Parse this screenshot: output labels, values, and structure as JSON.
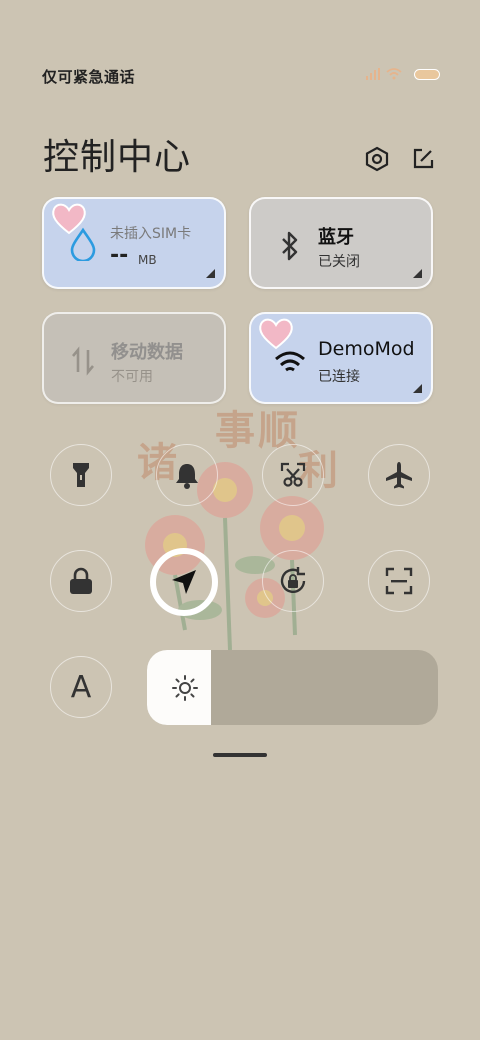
{
  "status_bar": {
    "carrier_text": "仅可紧急通话"
  },
  "header": {
    "title": "控制中心",
    "settings_icon": "hexagon-settings-icon",
    "edit_icon": "edit-icon"
  },
  "tiles": {
    "data_usage": {
      "line1": "未插入SIM卡",
      "value": "--",
      "unit": "MB",
      "icon": "water-drop-icon",
      "color": "#c6d3ec"
    },
    "bluetooth": {
      "line1": "蓝牙",
      "line2": "已关闭",
      "icon": "bluetooth-icon"
    },
    "mobile_data": {
      "line1": "移动数据",
      "line2": "不可用",
      "icon": "data-arrows-icon"
    },
    "wifi": {
      "line1": "DemoMod",
      "line2": "已连接",
      "icon": "wifi-icon",
      "color": "#c6d3ec"
    }
  },
  "toggles": [
    {
      "name": "flashlight",
      "icon": "flashlight-icon"
    },
    {
      "name": "silent",
      "icon": "bell-icon"
    },
    {
      "name": "screenshot",
      "icon": "scissors-icon"
    },
    {
      "name": "airplane-mode",
      "icon": "airplane-icon"
    },
    {
      "name": "lock-screen",
      "icon": "lock-icon"
    },
    {
      "name": "location",
      "icon": "location-arrow-icon"
    },
    {
      "name": "rotation-lock",
      "icon": "rotation-lock-icon"
    },
    {
      "name": "scanner",
      "icon": "scan-icon"
    },
    {
      "name": "reading-mode",
      "icon": "font-a-icon",
      "text": "A"
    }
  ],
  "brightness": {
    "level": 0.22,
    "icon": "sun-icon"
  },
  "colors": {
    "background": "#ccc4b3",
    "accent_tile": "#c6d3ec"
  }
}
